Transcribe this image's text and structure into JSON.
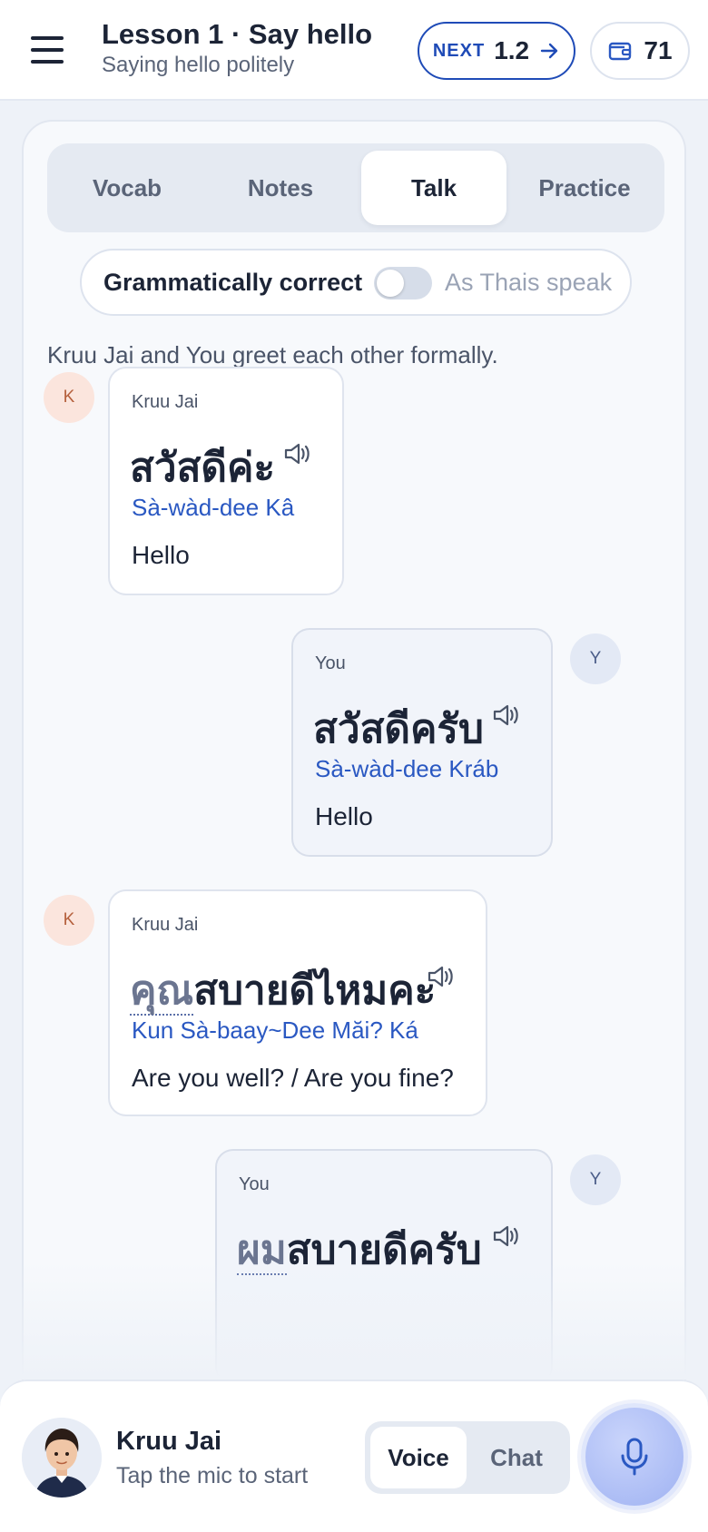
{
  "header": {
    "title": "Lesson 1 · Say hello",
    "subtitle": "Saying hello politely",
    "next_label": "NEXT",
    "next_lesson": "1.2",
    "wallet_count": "71"
  },
  "tabs": [
    {
      "label": "Vocab",
      "active": false
    },
    {
      "label": "Notes",
      "active": false
    },
    {
      "label": "Talk",
      "active": true
    },
    {
      "label": "Practice",
      "active": false
    }
  ],
  "mode_switch": {
    "left_label": "Grammatically correct",
    "right_label": "As Thais speak",
    "on": false
  },
  "scenario": "Kruu Jai and You greet each other formally.",
  "messages": [
    {
      "side": "them",
      "avatar": "K",
      "speaker": "Kruu Jai",
      "thai_highlight": "",
      "thai": "สวัสดีค่ะ",
      "translit": "Sà-wàd-dee Kâ",
      "english": "Hello"
    },
    {
      "side": "me",
      "avatar": "Y",
      "speaker": "You",
      "thai_highlight": "",
      "thai": "สวัสดีครับ",
      "translit": "Sà-wàd-dee Kráb",
      "english": "Hello"
    },
    {
      "side": "them",
      "avatar": "K",
      "speaker": "Kruu Jai",
      "thai_highlight": "คุณ",
      "thai": "สบายดีไหมคะ",
      "translit": "Kun Sà-baay~Dee Măi? Ká",
      "english": "Are you well? / Are you fine?"
    },
    {
      "side": "me",
      "avatar": "Y",
      "speaker": "You",
      "thai_highlight": "ผม",
      "thai": "สบายดีครับ",
      "translit": "",
      "english": ""
    }
  ],
  "bottom": {
    "tutor_name": "Kruu Jai",
    "hint": "Tap the mic to start",
    "modes": [
      {
        "label": "Voice",
        "active": true
      },
      {
        "label": "Chat",
        "active": false
      }
    ]
  },
  "colors": {
    "accent": "#1f4bb7",
    "translit": "#2a58c2",
    "mic": "#9fb2f2"
  }
}
